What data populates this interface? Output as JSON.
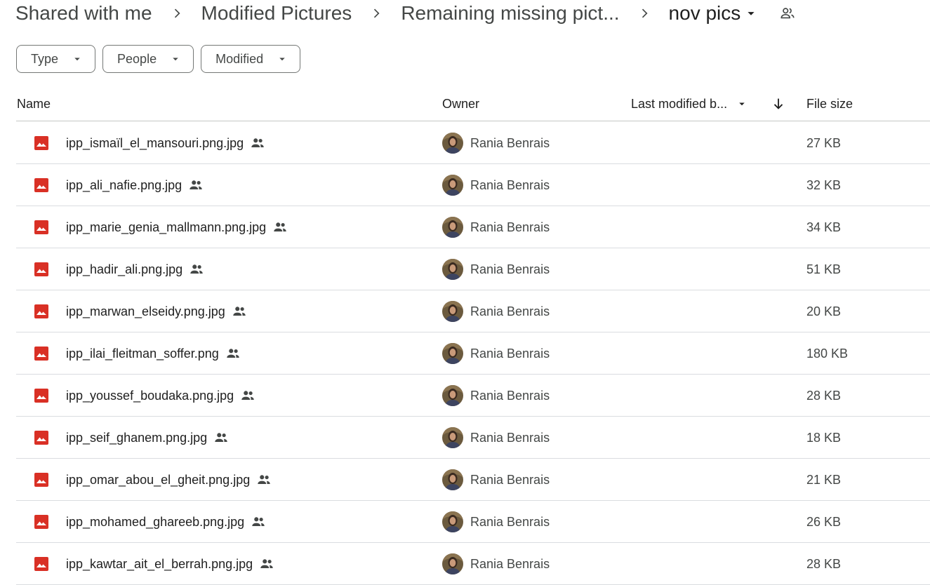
{
  "breadcrumb": {
    "items": [
      {
        "label": "Shared with me"
      },
      {
        "label": "Modified Pictures"
      },
      {
        "label": "Remaining missing pict..."
      },
      {
        "label": "nov pics"
      }
    ]
  },
  "filters": [
    {
      "label": "Type"
    },
    {
      "label": "People"
    },
    {
      "label": "Modified"
    }
  ],
  "table": {
    "columns": {
      "name": "Name",
      "owner": "Owner",
      "modified": "Last modified b...",
      "size": "File size"
    },
    "rows": [
      {
        "name": "ipp_ismaïl_el_mansouri.png.jpg",
        "owner": "Rania Benrais",
        "size": "27 KB"
      },
      {
        "name": "ipp_ali_nafie.png.jpg",
        "owner": "Rania Benrais",
        "size": "32 KB"
      },
      {
        "name": "ipp_marie_genia_mallmann.png.jpg",
        "owner": "Rania Benrais",
        "size": "34 KB"
      },
      {
        "name": "ipp_hadir_ali.png.jpg",
        "owner": "Rania Benrais",
        "size": "51 KB"
      },
      {
        "name": "ipp_marwan_elseidy.png.jpg",
        "owner": "Rania Benrais",
        "size": "20 KB"
      },
      {
        "name": "ipp_ilai_fleitman_soffer.png",
        "owner": "Rania Benrais",
        "size": "180 KB"
      },
      {
        "name": "ipp_youssef_boudaka.png.jpg",
        "owner": "Rania Benrais",
        "size": "28 KB"
      },
      {
        "name": "ipp_seif_ghanem.png.jpg",
        "owner": "Rania Benrais",
        "size": "18 KB"
      },
      {
        "name": "ipp_omar_abou_el_gheit.png.jpg",
        "owner": "Rania Benrais",
        "size": "21 KB"
      },
      {
        "name": "ipp_mohamed_ghareeb.png.jpg",
        "owner": "Rania Benrais",
        "size": "26 KB"
      },
      {
        "name": "ipp_kawtar_ait_el_berrah.png.jpg",
        "owner": "Rania Benrais",
        "size": "28 KB"
      }
    ]
  },
  "icons": {
    "file": "image-file-icon",
    "shared": "shared-people-icon",
    "folder_share": "people-outline-icon",
    "sort": "arrow-down-icon",
    "dropdown": "caret-down-icon",
    "separator": "chevron-right-icon"
  },
  "colors": {
    "image_icon": "#d93025",
    "text_primary": "#1f1f1f",
    "text_secondary": "#444746",
    "divider": "#dadce0"
  }
}
